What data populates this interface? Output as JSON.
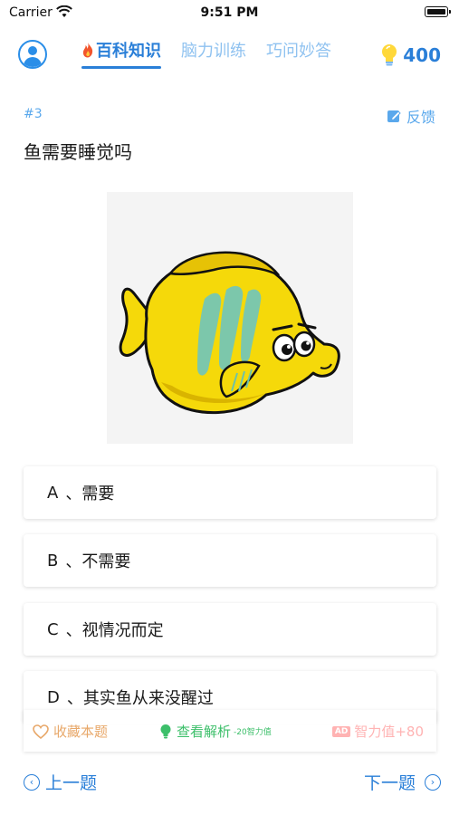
{
  "status_bar": {
    "carrier": "Carrier",
    "time": "9:51 PM"
  },
  "header": {
    "tabs": [
      {
        "label": "百科知识",
        "active": true
      },
      {
        "label": "脑力训练",
        "active": false
      },
      {
        "label": "巧问妙答",
        "active": false
      }
    ],
    "score": "400"
  },
  "question": {
    "number": "#3",
    "feedback_label": "反馈",
    "text": "鱼需要睡觉吗"
  },
  "options": [
    {
      "letter": "A",
      "text": "、需要"
    },
    {
      "letter": "B",
      "text": "、不需要"
    },
    {
      "letter": "C",
      "text": "、视情况而定"
    },
    {
      "letter": "D",
      "text": "、其实鱼从来没醒过"
    }
  ],
  "actions": {
    "favorite": "收藏本题",
    "explanation": "查看解析",
    "explanation_cost": "-20智力值",
    "ad_badge": "AD",
    "ad_reward": "智力值+80"
  },
  "nav": {
    "prev": "上一题",
    "next": "下一题"
  },
  "colors": {
    "accent": "#2a7fd8",
    "green": "#3cbf6a",
    "orange": "#e8a86a",
    "fish": "#f5d90a"
  }
}
